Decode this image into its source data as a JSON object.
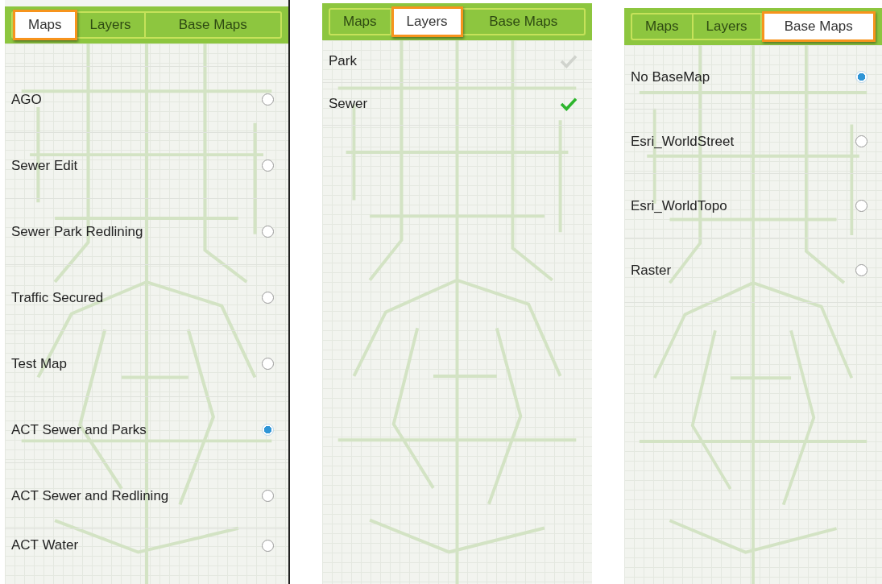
{
  "panels": [
    {
      "kind": "radio",
      "tabs": [
        {
          "label": "Maps",
          "selected": true
        },
        {
          "label": "Layers",
          "selected": false
        },
        {
          "label": "Base Maps",
          "selected": false
        }
      ],
      "items": [
        {
          "label": "AGO",
          "selected": false
        },
        {
          "label": "Sewer Edit",
          "selected": false
        },
        {
          "label": "Sewer Park Redlining",
          "selected": false
        },
        {
          "label": "Traffic Secured",
          "selected": false
        },
        {
          "label": "Test Map",
          "selected": false
        },
        {
          "label": "ACT Sewer and Parks",
          "selected": true
        },
        {
          "label": "ACT Sewer and Redlining",
          "selected": false
        },
        {
          "label": "ACT Water",
          "selected": false
        }
      ]
    },
    {
      "kind": "check",
      "tabs": [
        {
          "label": "Maps",
          "selected": false
        },
        {
          "label": "Layers",
          "selected": true
        },
        {
          "label": "Base Maps",
          "selected": false
        }
      ],
      "items": [
        {
          "label": "Park",
          "checked": false
        },
        {
          "label": "Sewer",
          "checked": true
        }
      ]
    },
    {
      "kind": "radio",
      "tabs": [
        {
          "label": "Maps",
          "selected": false
        },
        {
          "label": "Layers",
          "selected": false
        },
        {
          "label": "Base Maps",
          "selected": true
        }
      ],
      "items": [
        {
          "label": "No BaseMap",
          "selected": true
        },
        {
          "label": "Esri_WorldStreet",
          "selected": false
        },
        {
          "label": "Esri_WorldTopo",
          "selected": false
        },
        {
          "label": "Raster",
          "selected": false
        }
      ]
    }
  ]
}
